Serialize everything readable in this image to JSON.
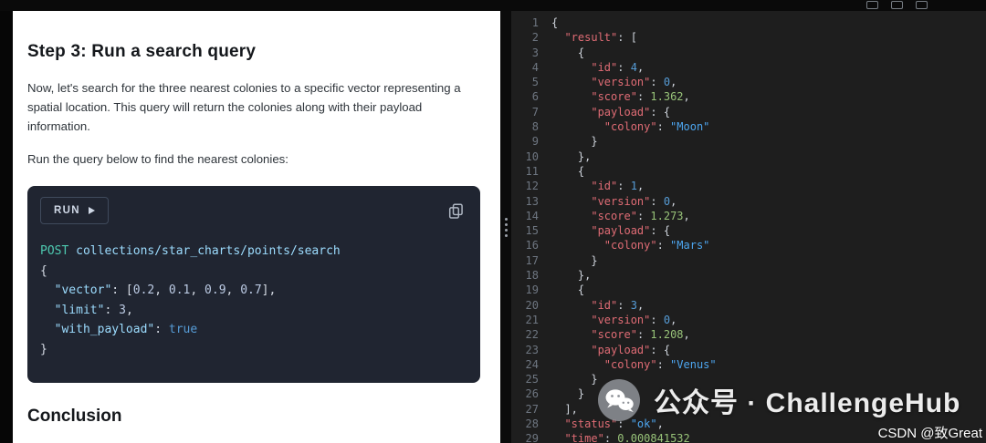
{
  "top_bar": {
    "icons": [
      "grid-icon",
      "bookmark-icon",
      "panel-icon"
    ]
  },
  "tutorial": {
    "title": "Step 3: Run a search query",
    "intro": "Now, let's search for the three nearest colonies to a specific vector representing a spatial location. This query will return the colonies along with their payload information.",
    "instruction": "Run the query below to find the nearest colonies:",
    "run_label": "RUN",
    "conclusion_title": "Conclusion",
    "request_code": [
      [
        [
          "m",
          "POST"
        ],
        [
          "p",
          " "
        ],
        [
          "pa",
          "collections/star_charts/points/search"
        ]
      ],
      [
        [
          "p",
          "{"
        ]
      ],
      [
        [
          "p",
          "  "
        ],
        [
          "k",
          "\"vector\""
        ],
        [
          "p",
          ": ["
        ],
        [
          "n",
          "0.2"
        ],
        [
          "p",
          ", "
        ],
        [
          "n",
          "0.1"
        ],
        [
          "p",
          ", "
        ],
        [
          "n",
          "0.9"
        ],
        [
          "p",
          ", "
        ],
        [
          "n",
          "0.7"
        ],
        [
          "p",
          "],"
        ]
      ],
      [
        [
          "p",
          "  "
        ],
        [
          "k",
          "\"limit\""
        ],
        [
          "p",
          ": "
        ],
        [
          "n",
          "3"
        ],
        [
          "p",
          ","
        ]
      ],
      [
        [
          "p",
          "  "
        ],
        [
          "k",
          "\"with_payload\""
        ],
        [
          "p",
          ": "
        ],
        [
          "b",
          "true"
        ]
      ],
      [
        [
          "p",
          "}"
        ]
      ]
    ]
  },
  "editor": {
    "lines": [
      [
        [
          "p",
          "{"
        ]
      ],
      [
        [
          "p",
          "  "
        ],
        [
          "k",
          "\"result\""
        ],
        [
          "p",
          ": ["
        ]
      ],
      [
        [
          "p",
          "    {"
        ]
      ],
      [
        [
          "p",
          "      "
        ],
        [
          "k",
          "\"id\""
        ],
        [
          "p",
          ": "
        ],
        [
          "i",
          "4"
        ],
        [
          "p",
          ","
        ]
      ],
      [
        [
          "p",
          "      "
        ],
        [
          "k",
          "\"version\""
        ],
        [
          "p",
          ": "
        ],
        [
          "i",
          "0"
        ],
        [
          "p",
          ","
        ]
      ],
      [
        [
          "p",
          "      "
        ],
        [
          "k",
          "\"score\""
        ],
        [
          "p",
          ": "
        ],
        [
          "f",
          "1.362"
        ],
        [
          "p",
          ","
        ]
      ],
      [
        [
          "p",
          "      "
        ],
        [
          "k",
          "\"payload\""
        ],
        [
          "p",
          ": {"
        ]
      ],
      [
        [
          "p",
          "        "
        ],
        [
          "k",
          "\"colony\""
        ],
        [
          "p",
          ": "
        ],
        [
          "s",
          "\"Moon\""
        ]
      ],
      [
        [
          "p",
          "      }"
        ]
      ],
      [
        [
          "p",
          "    },"
        ]
      ],
      [
        [
          "p",
          "    {"
        ]
      ],
      [
        [
          "p",
          "      "
        ],
        [
          "k",
          "\"id\""
        ],
        [
          "p",
          ": "
        ],
        [
          "i",
          "1"
        ],
        [
          "p",
          ","
        ]
      ],
      [
        [
          "p",
          "      "
        ],
        [
          "k",
          "\"version\""
        ],
        [
          "p",
          ": "
        ],
        [
          "i",
          "0"
        ],
        [
          "p",
          ","
        ]
      ],
      [
        [
          "p",
          "      "
        ],
        [
          "k",
          "\"score\""
        ],
        [
          "p",
          ": "
        ],
        [
          "f",
          "1.273"
        ],
        [
          "p",
          ","
        ]
      ],
      [
        [
          "p",
          "      "
        ],
        [
          "k",
          "\"payload\""
        ],
        [
          "p",
          ": {"
        ]
      ],
      [
        [
          "p",
          "        "
        ],
        [
          "k",
          "\"colony\""
        ],
        [
          "p",
          ": "
        ],
        [
          "s",
          "\"Mars\""
        ]
      ],
      [
        [
          "p",
          "      }"
        ]
      ],
      [
        [
          "p",
          "    },"
        ]
      ],
      [
        [
          "p",
          "    {"
        ]
      ],
      [
        [
          "p",
          "      "
        ],
        [
          "k",
          "\"id\""
        ],
        [
          "p",
          ": "
        ],
        [
          "i",
          "3"
        ],
        [
          "p",
          ","
        ]
      ],
      [
        [
          "p",
          "      "
        ],
        [
          "k",
          "\"version\""
        ],
        [
          "p",
          ": "
        ],
        [
          "i",
          "0"
        ],
        [
          "p",
          ","
        ]
      ],
      [
        [
          "p",
          "      "
        ],
        [
          "k",
          "\"score\""
        ],
        [
          "p",
          ": "
        ],
        [
          "f",
          "1.208"
        ],
        [
          "p",
          ","
        ]
      ],
      [
        [
          "p",
          "      "
        ],
        [
          "k",
          "\"payload\""
        ],
        [
          "p",
          ": {"
        ]
      ],
      [
        [
          "p",
          "        "
        ],
        [
          "k",
          "\"colony\""
        ],
        [
          "p",
          ": "
        ],
        [
          "s",
          "\"Venus\""
        ]
      ],
      [
        [
          "p",
          "      }"
        ]
      ],
      [
        [
          "p",
          "    }"
        ]
      ],
      [
        [
          "p",
          "  ],"
        ]
      ],
      [
        [
          "p",
          "  "
        ],
        [
          "k",
          "\"status\""
        ],
        [
          "p",
          ": "
        ],
        [
          "s",
          "\"ok\""
        ],
        [
          "p",
          ","
        ]
      ],
      [
        [
          "p",
          "  "
        ],
        [
          "k",
          "\"time\""
        ],
        [
          "p",
          ": "
        ],
        [
          "f",
          "0.000841532"
        ]
      ]
    ]
  },
  "watermark": {
    "icon": "wechat-icon",
    "text": "公众号 · ChallengeHub",
    "credit": "CSDN @致Great"
  },
  "colors": {
    "code_block_bg": "#202531",
    "run_border": "#3f4a5c",
    "method": "#4ec9b0",
    "request_path": "#9cdcfe",
    "request_key": "#9cdcfe",
    "request_number": "#bccbe4",
    "boolean": "#569cd6",
    "editor_bg": "#1e1e1e",
    "editor_key": "#e06c75",
    "editor_string": "#4da6f0",
    "editor_int": "#569cd6",
    "editor_float": "#98c379",
    "gutter": "#6e7681"
  }
}
